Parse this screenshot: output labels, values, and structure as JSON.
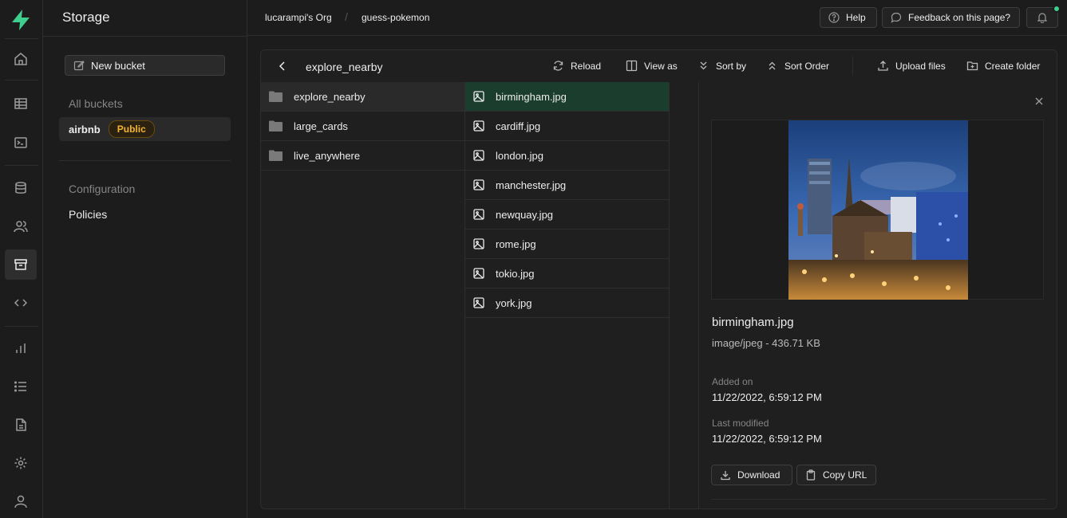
{
  "app": {
    "section_title": "Storage"
  },
  "rail": {
    "items": [
      "home-icon",
      "table-icon",
      "terminal-icon",
      "database-icon",
      "users-icon",
      "storage-icon",
      "code-icon",
      "reports-icon",
      "logs-icon",
      "docs-icon",
      "settings-icon",
      "user-icon"
    ],
    "active": "storage-icon"
  },
  "sidebar": {
    "new_bucket_label": "New bucket",
    "all_buckets_label": "All buckets",
    "bucket": {
      "name": "airbnb",
      "badge": "Public"
    },
    "configuration_label": "Configuration",
    "policies_label": "Policies"
  },
  "header": {
    "org": "lucarampi's Org",
    "project": "guess-pokemon",
    "crumb_sep": "/",
    "help_label": "Help",
    "feedback_label": "Feedback on this page?"
  },
  "toolbar": {
    "path": "explore_nearby",
    "reload_label": "Reload",
    "view_as_label": "View as",
    "sort_by_label": "Sort by",
    "sort_order_label": "Sort Order",
    "upload_label": "Upload files",
    "create_folder_label": "Create folder"
  },
  "folders": [
    "explore_nearby",
    "large_cards",
    "live_anywhere"
  ],
  "files": [
    "birmingham.jpg",
    "cardiff.jpg",
    "london.jpg",
    "manchester.jpg",
    "newquay.jpg",
    "rome.jpg",
    "tokio.jpg",
    "york.jpg"
  ],
  "preview": {
    "name": "birmingham.jpg",
    "meta": "image/jpeg - 436.71 KB",
    "added_label": "Added on",
    "added_value": "11/22/2022, 6:59:12 PM",
    "modified_label": "Last modified",
    "modified_value": "11/22/2022, 6:59:12 PM",
    "download_label": "Download",
    "copy_url_label": "Copy URL"
  },
  "colors": {
    "accent": "#3ecf8e",
    "badge": "#f5b32e",
    "selected_file_bg": "#1b3d2e"
  }
}
